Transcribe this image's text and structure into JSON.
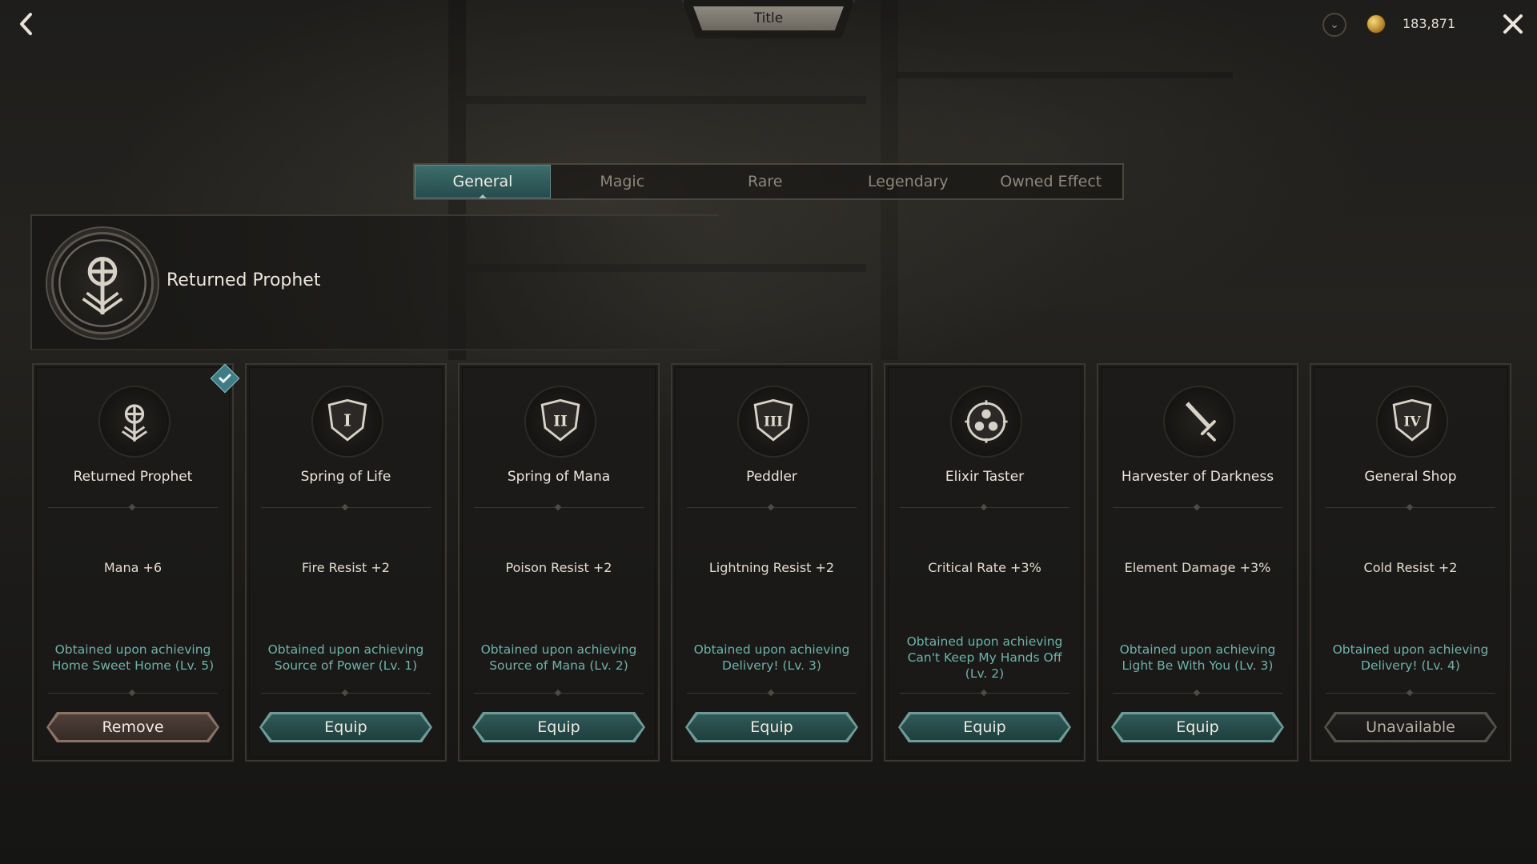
{
  "header": {
    "title": "Title",
    "currency_amount": "183,871"
  },
  "tabs": [
    {
      "label": "General",
      "active": true
    },
    {
      "label": "Magic",
      "active": false
    },
    {
      "label": "Rare",
      "active": false
    },
    {
      "label": "Legendary",
      "active": false
    },
    {
      "label": "Owned Effect",
      "active": false
    }
  ],
  "equipped": {
    "name": "Returned Prophet"
  },
  "cards": [
    {
      "name": "Returned Prophet",
      "stat": "Mana +6",
      "condition_lines": [
        "Obtained upon achieving",
        "Home Sweet Home (Lv. 5)"
      ],
      "button": "Remove",
      "equipped": true
    },
    {
      "name": "Spring of Life",
      "stat": "Fire Resist +2",
      "condition_lines": [
        "Obtained upon achieving",
        "Source of Power (Lv. 1)"
      ],
      "button": "Equip",
      "equipped": false
    },
    {
      "name": "Spring of Mana",
      "stat": "Poison Resist +2",
      "condition_lines": [
        "Obtained upon achieving",
        "Source of Mana (Lv. 2)"
      ],
      "button": "Equip",
      "equipped": false
    },
    {
      "name": "Peddler",
      "stat": "Lightning Resist +2",
      "condition_lines": [
        "Obtained upon achieving",
        "Delivery! (Lv. 3)"
      ],
      "button": "Equip",
      "equipped": false
    },
    {
      "name": "Elixir Taster",
      "stat": "Critical Rate +3%",
      "condition_lines": [
        "Obtained upon achieving",
        "Can't Keep My Hands Off",
        "(Lv. 2)"
      ],
      "button": "Equip",
      "equipped": false
    },
    {
      "name": "Harvester of Darkness",
      "stat": "Element Damage +3%",
      "condition_lines": [
        "Obtained upon achieving",
        "Light Be With You (Lv. 3)"
      ],
      "button": "Equip",
      "equipped": false
    },
    {
      "name": "General Shop",
      "stat": "Cold Resist +2",
      "condition_lines": [
        "Obtained upon achieving",
        "Delivery! (Lv. 4)"
      ],
      "button": "Unavailable",
      "equipped": false
    }
  ],
  "icons": {
    "back": "chevron-left-icon",
    "dropdown": "chevron-down-icon",
    "currency": "gold-coin-icon",
    "close": "close-icon",
    "equipped_marker": "checkmark-icon",
    "card_emblems": [
      "prophet-emblem-icon",
      "shield-one-icon",
      "shield-two-icon",
      "shield-three-icon",
      "orb-emblem-icon",
      "sword-emblem-icon",
      "shield-four-icon"
    ]
  },
  "colors": {
    "accent_teal": "#2f5a58",
    "condition_text": "#6fb1aa",
    "remove_button": "#4f3f38"
  }
}
